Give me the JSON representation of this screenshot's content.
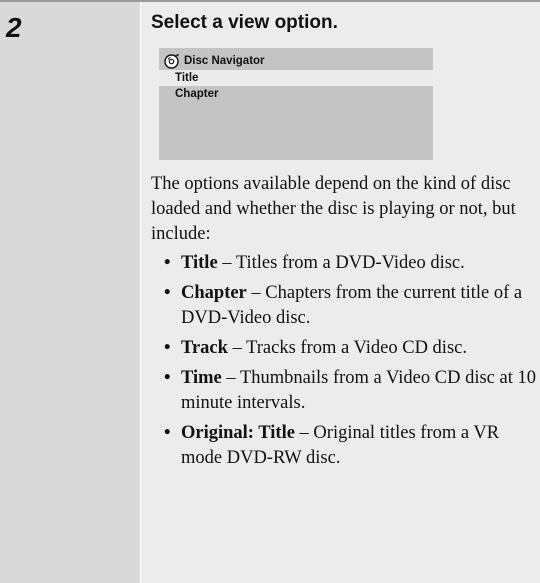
{
  "step": {
    "number": "2",
    "heading": "Select a view option."
  },
  "osd": {
    "icon": "disc-navigator-icon",
    "title": "Disc Navigator",
    "items": [
      {
        "label": "Title",
        "selected": true
      },
      {
        "label": "Chapter",
        "selected": false
      }
    ]
  },
  "intro": "The options available depend on the kind of disc loaded and whether the disc is playing or not, but include:",
  "options": [
    {
      "term": "Title",
      "desc": "Titles from a DVD-Video disc."
    },
    {
      "term": "Chapter",
      "desc": "Chapters from the current title of a DVD-Video disc."
    },
    {
      "term": "Track",
      "desc": "Tracks from a Video CD disc."
    },
    {
      "term": "Time",
      "desc": "Thumbnails from a Video CD disc at 10 minute intervals."
    },
    {
      "term": "Original: Title",
      "desc": "Original titles from a VR mode DVD-RW disc."
    }
  ],
  "colors": {
    "step_column": "#d9d9d9",
    "content_column": "#ececec",
    "osd_background": "#c4c4c4",
    "osd_highlight": "#ebebeb"
  }
}
